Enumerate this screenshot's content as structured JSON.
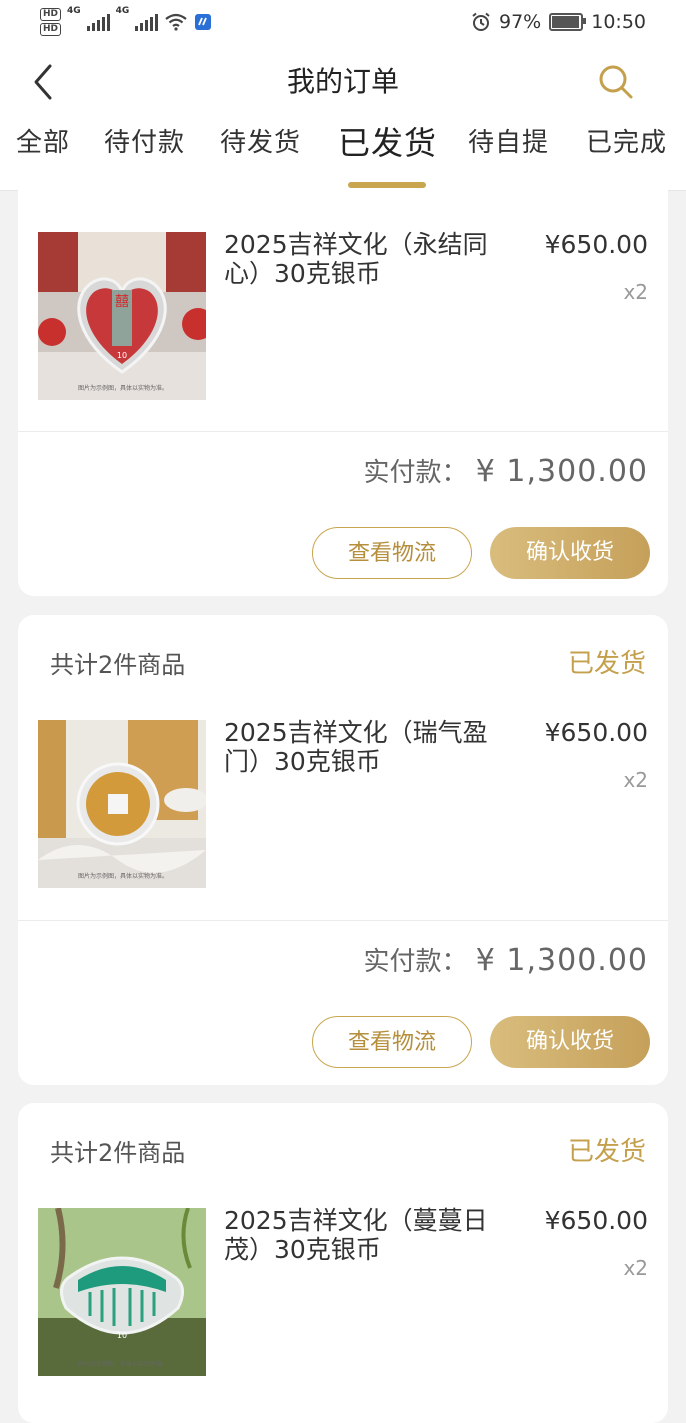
{
  "status_bar": {
    "hd1": "HD",
    "hd2": "HD",
    "net1": "4G",
    "net2": "4G",
    "battery": "97%",
    "time": "10:50"
  },
  "header": {
    "title": "我的订单"
  },
  "tabs": [
    {
      "label": "全部"
    },
    {
      "label": "待付款"
    },
    {
      "label": "待发货"
    },
    {
      "label": "已发货",
      "active": true
    },
    {
      "label": "待自提"
    },
    {
      "label": "已完成"
    }
  ],
  "orders": [
    {
      "count": "",
      "status": "",
      "product": {
        "name": "2025吉祥文化（永结同心）30克银币",
        "price": "¥650.00",
        "qty": "x2",
        "image_caption": "图片为示例图，具体以实物为准。"
      },
      "paid_label": "实付款：",
      "paid_amount": "¥ 1,300.00",
      "logistics_btn": "查看物流",
      "confirm_btn": "确认收货"
    },
    {
      "count": "共计2件商品",
      "status": "已发货",
      "product": {
        "name": "2025吉祥文化（瑞气盈门）30克银币",
        "price": "¥650.00",
        "qty": "x2",
        "image_caption": "图片为示例图，具体以实物为准。"
      },
      "paid_label": "实付款：",
      "paid_amount": "¥ 1,300.00",
      "logistics_btn": "查看物流",
      "confirm_btn": "确认收货"
    },
    {
      "count": "共计2件商品",
      "status": "已发货",
      "product": {
        "name": "2025吉祥文化（蔓蔓日茂）30克银币",
        "price": "¥650.00",
        "qty": "x2",
        "image_caption": "图片为示例图，具体以实物为准。"
      }
    }
  ],
  "colors": {
    "accent": "#c9a550",
    "page_bg": "#f2f2f2"
  }
}
